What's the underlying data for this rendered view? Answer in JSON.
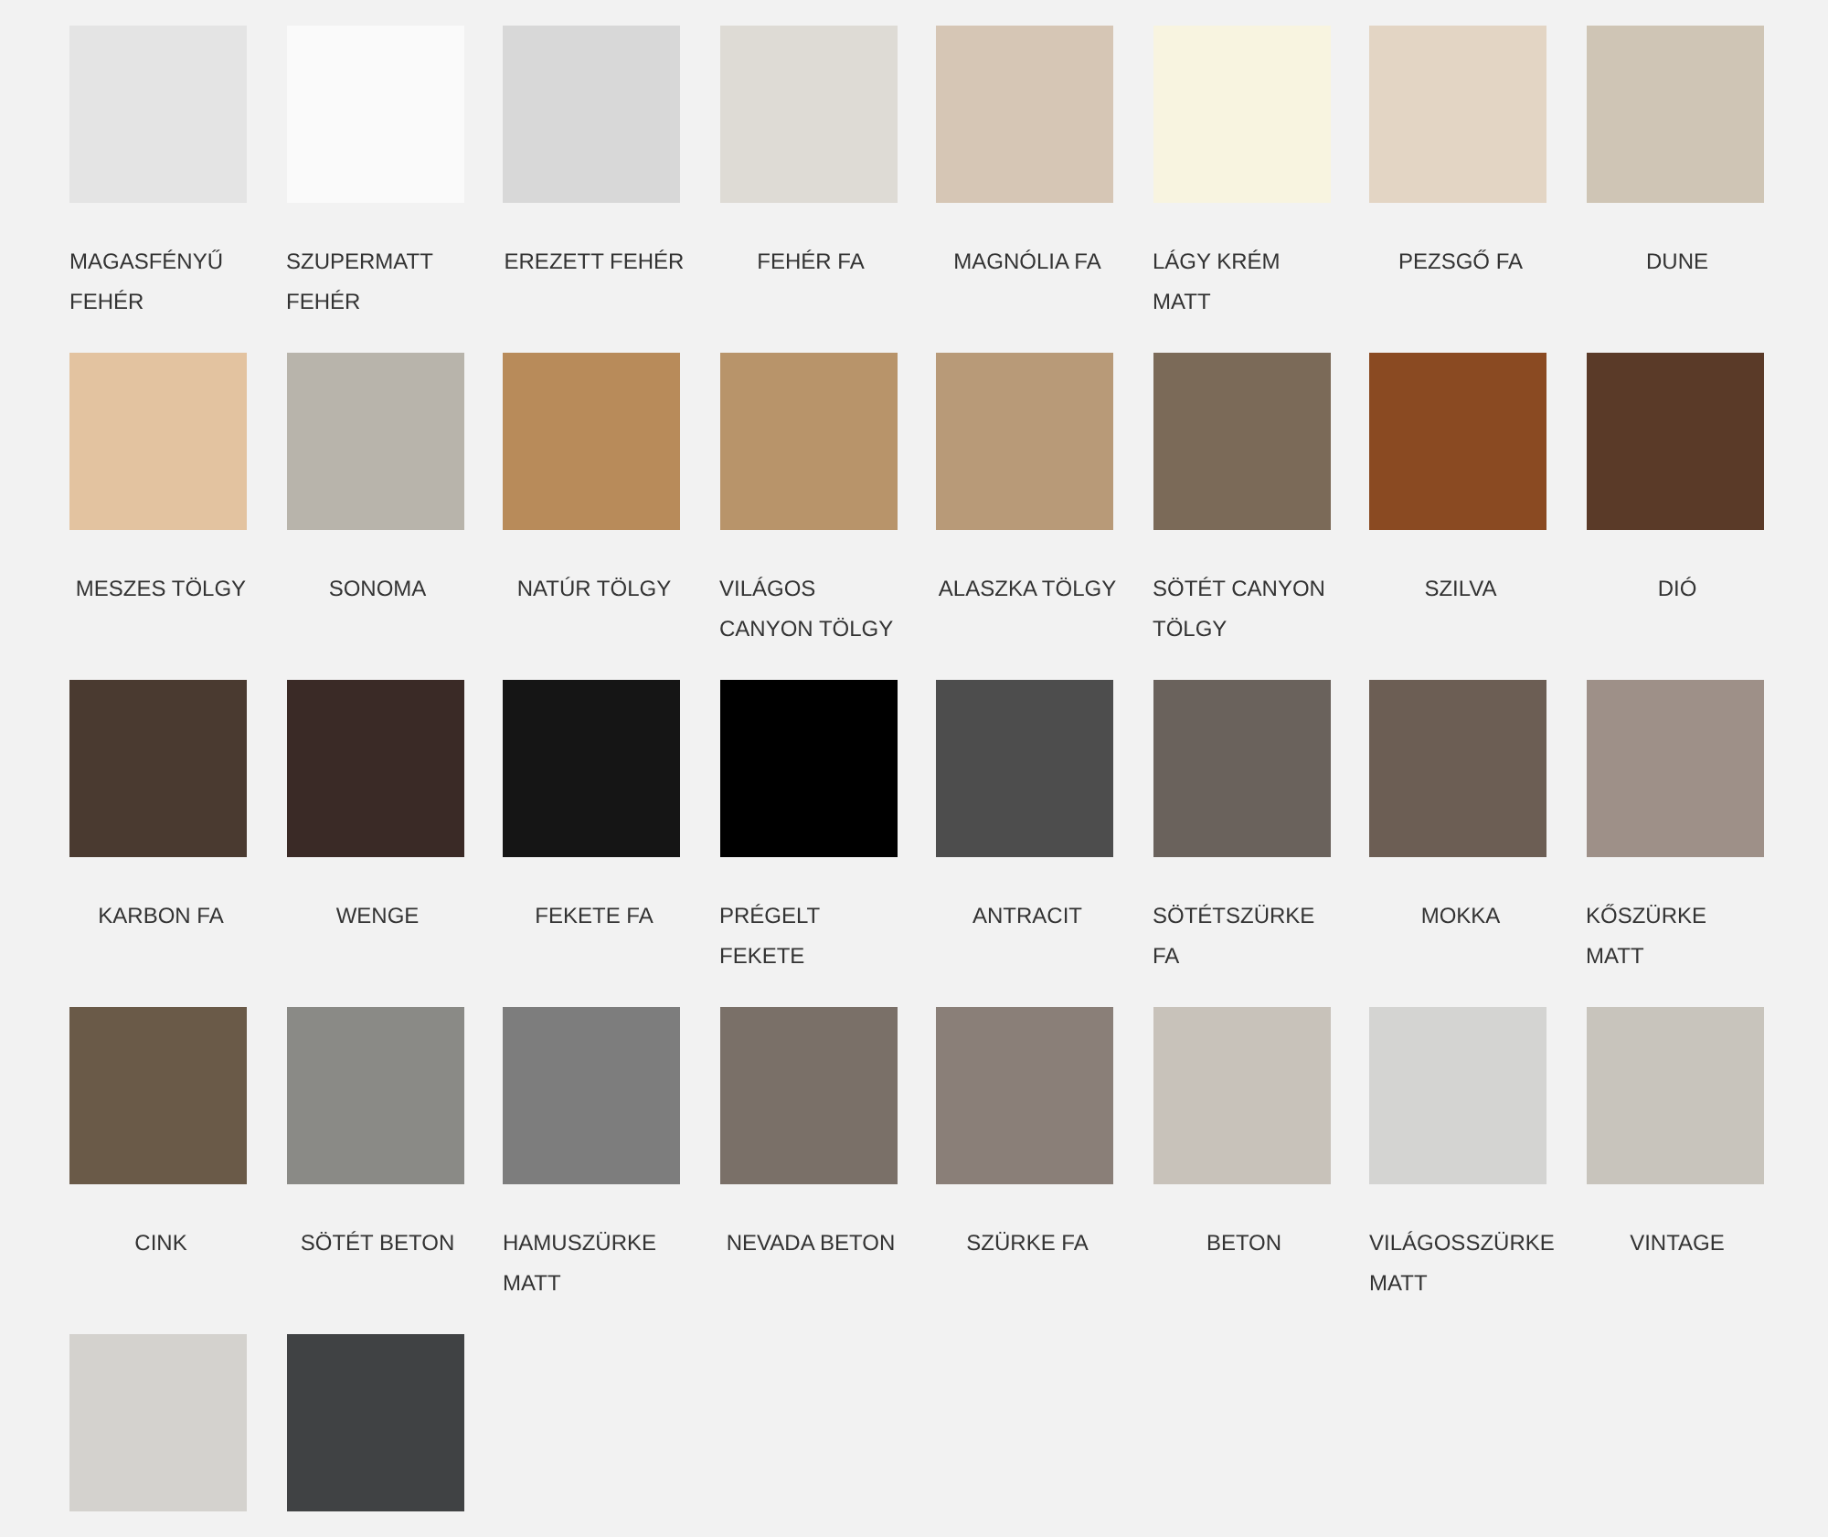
{
  "swatches": [
    {
      "label": "MAGASFÉNYŰ FEHÉR",
      "color": "#e4e4e4"
    },
    {
      "label": "SZUPERMATT FEHÉR",
      "color": "#fafafa"
    },
    {
      "label": "EREZETT FEHÉR",
      "color": "#d8d8d8"
    },
    {
      "label": "FEHÉR FA",
      "color": "#dedbd5"
    },
    {
      "label": "MAGNÓLIA FA",
      "color": "#d6c6b5"
    },
    {
      "label": "LÁGY KRÉM MATT",
      "color": "#f8f4e0"
    },
    {
      "label": "PEZSGŐ FA",
      "color": "#e3d5c4"
    },
    {
      "label": "DUNE",
      "color": "#cfc5b5"
    },
    {
      "label": "MESZES TÖLGY",
      "color": "#e3c3a0"
    },
    {
      "label": "SONOMA",
      "color": "#b8b4ab"
    },
    {
      "label": "NATÚR TÖLGY",
      "color": "#b88b5a"
    },
    {
      "label": "VILÁGOS CANYON TÖLGY",
      "color": "#b8946a"
    },
    {
      "label": "ALASZKA TÖLGY",
      "color": "#b89a78"
    },
    {
      "label": "SÖTÉT CANYON TÖLGY",
      "color": "#7b6a58"
    },
    {
      "label": "SZILVA",
      "color": "#8a4a22"
    },
    {
      "label": "DIÓ",
      "color": "#5a3a28"
    },
    {
      "label": "KARBON FA",
      "color": "#4a3a30"
    },
    {
      "label": "WENGE",
      "color": "#3a2a26"
    },
    {
      "label": "FEKETE FA",
      "color": "#151515"
    },
    {
      "label": "PRÉGELT FEKETE",
      "color": "#000000"
    },
    {
      "label": "ANTRACIT",
      "color": "#4d4d4d"
    },
    {
      "label": "SÖTÉTSZÜRKE FA",
      "color": "#6a625c"
    },
    {
      "label": "MOKKA",
      "color": "#6c5e54"
    },
    {
      "label": "KŐSZÜRKE MATT",
      "color": "#9e9088"
    },
    {
      "label": "CINK",
      "color": "#6a5a48"
    },
    {
      "label": "SÖTÉT BETON",
      "color": "#8a8a86"
    },
    {
      "label": "HAMUSZÜRKE MATT",
      "color": "#7d7d7d"
    },
    {
      "label": "NEVADA BETON",
      "color": "#7a7068"
    },
    {
      "label": "SZÜRKE FA",
      "color": "#8a7f78"
    },
    {
      "label": "BETON",
      "color": "#c8c2ba"
    },
    {
      "label": "VILÁGOSSZÜRKE MATT",
      "color": "#d4d4d2"
    },
    {
      "label": "VINTAGE",
      "color": "#c8c4bc"
    },
    {
      "color": "#d4d2ce"
    },
    {
      "color": "#404244"
    }
  ]
}
